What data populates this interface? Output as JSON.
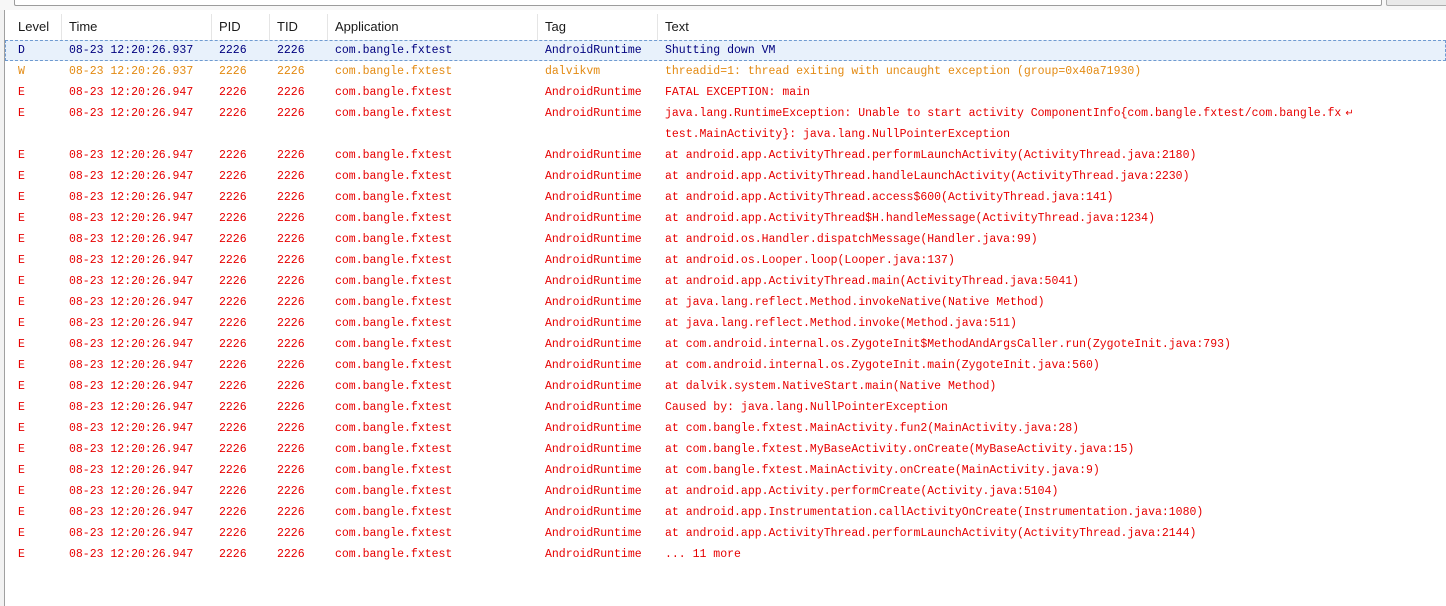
{
  "window": {
    "columns": {
      "level": "Level",
      "time": "Time",
      "pid": "PID",
      "tid": "TID",
      "application": "Application",
      "tag": "Tag",
      "text": "Text"
    }
  },
  "colors": {
    "D": "#00007e",
    "W": "#e38a12",
    "E": "#e60000",
    "selection": "#e8f1fb"
  },
  "log": [
    {
      "level": "D",
      "time": "08-23 12:20:26.937",
      "pid": "2226",
      "tid": "2226",
      "app": "com.bangle.fxtest",
      "tag": "AndroidRuntime",
      "text": "Shutting down VM"
    },
    {
      "level": "W",
      "time": "08-23 12:20:26.937",
      "pid": "2226",
      "tid": "2226",
      "app": "com.bangle.fxtest",
      "tag": "dalvikvm",
      "text": "threadid=1: thread exiting with uncaught exception (group=0x40a71930)"
    },
    {
      "level": "E",
      "time": "08-23 12:20:26.947",
      "pid": "2226",
      "tid": "2226",
      "app": "com.bangle.fxtest",
      "tag": "AndroidRuntime",
      "text": "FATAL EXCEPTION: main"
    },
    {
      "level": "E",
      "time": "08-23 12:20:26.947",
      "pid": "2226",
      "tid": "2226",
      "app": "com.bangle.fxtest",
      "tag": "AndroidRuntime",
      "text": "java.lang.RuntimeException: Unable to start activity ComponentInfo{com.bangle.fxtest/com.bangle.fx",
      "text2": "test.MainActivity}: java.lang.NullPointerException"
    },
    {
      "level": "E",
      "time": "08-23 12:20:26.947",
      "pid": "2226",
      "tid": "2226",
      "app": "com.bangle.fxtest",
      "tag": "AndroidRuntime",
      "text": "at android.app.ActivityThread.performLaunchActivity(ActivityThread.java:2180)"
    },
    {
      "level": "E",
      "time": "08-23 12:20:26.947",
      "pid": "2226",
      "tid": "2226",
      "app": "com.bangle.fxtest",
      "tag": "AndroidRuntime",
      "text": "at android.app.ActivityThread.handleLaunchActivity(ActivityThread.java:2230)"
    },
    {
      "level": "E",
      "time": "08-23 12:20:26.947",
      "pid": "2226",
      "tid": "2226",
      "app": "com.bangle.fxtest",
      "tag": "AndroidRuntime",
      "text": "at android.app.ActivityThread.access$600(ActivityThread.java:141)"
    },
    {
      "level": "E",
      "time": "08-23 12:20:26.947",
      "pid": "2226",
      "tid": "2226",
      "app": "com.bangle.fxtest",
      "tag": "AndroidRuntime",
      "text": "at android.app.ActivityThread$H.handleMessage(ActivityThread.java:1234)"
    },
    {
      "level": "E",
      "time": "08-23 12:20:26.947",
      "pid": "2226",
      "tid": "2226",
      "app": "com.bangle.fxtest",
      "tag": "AndroidRuntime",
      "text": "at android.os.Handler.dispatchMessage(Handler.java:99)"
    },
    {
      "level": "E",
      "time": "08-23 12:20:26.947",
      "pid": "2226",
      "tid": "2226",
      "app": "com.bangle.fxtest",
      "tag": "AndroidRuntime",
      "text": "at android.os.Looper.loop(Looper.java:137)"
    },
    {
      "level": "E",
      "time": "08-23 12:20:26.947",
      "pid": "2226",
      "tid": "2226",
      "app": "com.bangle.fxtest",
      "tag": "AndroidRuntime",
      "text": "at android.app.ActivityThread.main(ActivityThread.java:5041)"
    },
    {
      "level": "E",
      "time": "08-23 12:20:26.947",
      "pid": "2226",
      "tid": "2226",
      "app": "com.bangle.fxtest",
      "tag": "AndroidRuntime",
      "text": "at java.lang.reflect.Method.invokeNative(Native Method)"
    },
    {
      "level": "E",
      "time": "08-23 12:20:26.947",
      "pid": "2226",
      "tid": "2226",
      "app": "com.bangle.fxtest",
      "tag": "AndroidRuntime",
      "text": "at java.lang.reflect.Method.invoke(Method.java:511)"
    },
    {
      "level": "E",
      "time": "08-23 12:20:26.947",
      "pid": "2226",
      "tid": "2226",
      "app": "com.bangle.fxtest",
      "tag": "AndroidRuntime",
      "text": "at com.android.internal.os.ZygoteInit$MethodAndArgsCaller.run(ZygoteInit.java:793)"
    },
    {
      "level": "E",
      "time": "08-23 12:20:26.947",
      "pid": "2226",
      "tid": "2226",
      "app": "com.bangle.fxtest",
      "tag": "AndroidRuntime",
      "text": "at com.android.internal.os.ZygoteInit.main(ZygoteInit.java:560)"
    },
    {
      "level": "E",
      "time": "08-23 12:20:26.947",
      "pid": "2226",
      "tid": "2226",
      "app": "com.bangle.fxtest",
      "tag": "AndroidRuntime",
      "text": "at dalvik.system.NativeStart.main(Native Method)"
    },
    {
      "level": "E",
      "time": "08-23 12:20:26.947",
      "pid": "2226",
      "tid": "2226",
      "app": "com.bangle.fxtest",
      "tag": "AndroidRuntime",
      "text": "Caused by: java.lang.NullPointerException"
    },
    {
      "level": "E",
      "time": "08-23 12:20:26.947",
      "pid": "2226",
      "tid": "2226",
      "app": "com.bangle.fxtest",
      "tag": "AndroidRuntime",
      "text": "at com.bangle.fxtest.MainActivity.fun2(MainActivity.java:28)"
    },
    {
      "level": "E",
      "time": "08-23 12:20:26.947",
      "pid": "2226",
      "tid": "2226",
      "app": "com.bangle.fxtest",
      "tag": "AndroidRuntime",
      "text": "at com.bangle.fxtest.MyBaseActivity.onCreate(MyBaseActivity.java:15)"
    },
    {
      "level": "E",
      "time": "08-23 12:20:26.947",
      "pid": "2226",
      "tid": "2226",
      "app": "com.bangle.fxtest",
      "tag": "AndroidRuntime",
      "text": "at com.bangle.fxtest.MainActivity.onCreate(MainActivity.java:9)"
    },
    {
      "level": "E",
      "time": "08-23 12:20:26.947",
      "pid": "2226",
      "tid": "2226",
      "app": "com.bangle.fxtest",
      "tag": "AndroidRuntime",
      "text": "at android.app.Activity.performCreate(Activity.java:5104)"
    },
    {
      "level": "E",
      "time": "08-23 12:20:26.947",
      "pid": "2226",
      "tid": "2226",
      "app": "com.bangle.fxtest",
      "tag": "AndroidRuntime",
      "text": "at android.app.Instrumentation.callActivityOnCreate(Instrumentation.java:1080)"
    },
    {
      "level": "E",
      "time": "08-23 12:20:26.947",
      "pid": "2226",
      "tid": "2226",
      "app": "com.bangle.fxtest",
      "tag": "AndroidRuntime",
      "text": "at android.app.ActivityThread.performLaunchActivity(ActivityThread.java:2144)"
    },
    {
      "level": "E",
      "time": "08-23 12:20:26.947",
      "pid": "2226",
      "tid": "2226",
      "app": "com.bangle.fxtest",
      "tag": "AndroidRuntime",
      "text": "... 11 more"
    }
  ]
}
